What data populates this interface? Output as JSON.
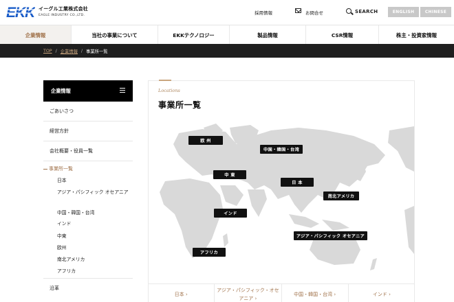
{
  "header": {
    "logo_text": "EKK",
    "company_jp": "イーグル工業株式会社",
    "company_en": "EAGLE INDUSTRY CO.,LTD.",
    "recruit": "採用情報",
    "contact": "お問合せ",
    "search": "SEARCH",
    "lang_en": "ENGLISH",
    "lang_cn": "CHINESE",
    "logo_color": "#1a5cc8"
  },
  "nav": {
    "items": [
      "企業情報",
      "当社の事業について",
      "EKKテクノロジー",
      "製品情報",
      "CSR情報",
      "株主・投資家情報"
    ]
  },
  "breadcrumb": {
    "top": "TOP",
    "sep": "/",
    "company": "企業情報",
    "current": "事業所一覧"
  },
  "sidebar": {
    "head": "企業情報",
    "items": [
      "ごあいさつ",
      "経営方針",
      "会社概要・役員一覧"
    ],
    "current": "事業所一覧",
    "sub": [
      "日本",
      "アジア・パシフィック オセアニア",
      "中国・韓国・台湾",
      "インド",
      "中東",
      "欧州",
      "南北アメリカ",
      "アフリカ"
    ],
    "next": "沿革"
  },
  "content": {
    "label": "Locations",
    "title": "事業所一覧",
    "regions": {
      "europe": "欧 州",
      "china": "中国・韓国・台湾",
      "middle_east": "中 東",
      "japan": "日 本",
      "americas": "南北アメリカ",
      "india": "インド",
      "asia_pacific": "アジア・パシフィック オセアニア",
      "africa": "アフリカ"
    },
    "tabs": [
      "日本 ›",
      "アジア・パシフィック・オセアニア ›",
      "中国・韓国・台湾 ›",
      "インド ›"
    ]
  },
  "colors": {
    "accent": "#a0724a",
    "gold": "#c9a57e",
    "dark": "#1f1f1f",
    "map_land": "#d9d9d9"
  }
}
